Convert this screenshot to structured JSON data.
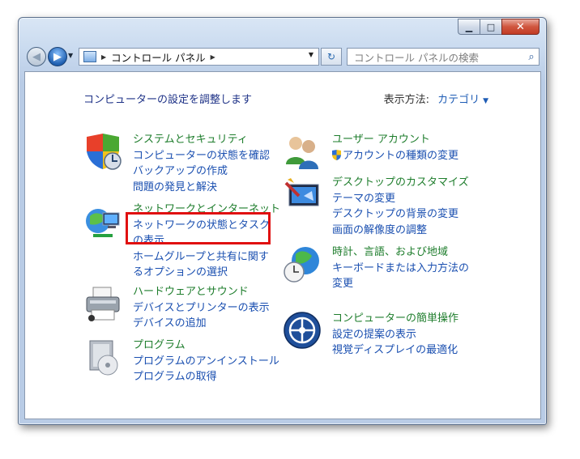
{
  "window": {
    "caption_buttons": {
      "minimize": "▁",
      "maximize": "□",
      "close": "✕"
    }
  },
  "nav": {
    "address_parts": [
      "コントロール パネル"
    ],
    "search_placeholder": "コントロール パネルの検索"
  },
  "content": {
    "title": "コンピューターの設定を調整します",
    "view_by_label": "表示方法:",
    "view_by_value": "カテゴリ"
  },
  "categories_left": [
    {
      "icon": "shield-security-icon",
      "heading": "システムとセキュリティ",
      "links": [
        "コンピューターの状態を確認",
        "バックアップの作成",
        "問題の発見と解決"
      ]
    },
    {
      "icon": "network-icon",
      "heading": "ネットワークとインターネット",
      "links": [
        "ネットワークの状態とタスクの表示",
        "ホームグループと共有に関するオプションの選択"
      ]
    },
    {
      "icon": "printer-icon",
      "heading": "ハードウェアとサウンド",
      "links": [
        "デバイスとプリンターの表示",
        "デバイスの追加"
      ]
    },
    {
      "icon": "programs-icon",
      "heading": "プログラム",
      "links": [
        "プログラムのアンインストール",
        "プログラムの取得"
      ]
    }
  ],
  "categories_right": [
    {
      "icon": "user-accounts-icon",
      "heading": "ユーザー アカウント",
      "links": [
        "アカウントの種類の変更"
      ]
    },
    {
      "icon": "appearance-icon",
      "heading": "デスクトップのカスタマイズ",
      "links": [
        "テーマの変更",
        "デスクトップの背景の変更",
        "画面の解像度の調整"
      ]
    },
    {
      "icon": "clock-globe-icon",
      "heading": "時計、言語、および地域",
      "links": [
        "キーボードまたは入力方法の変更"
      ]
    },
    {
      "icon": "ease-of-access-icon",
      "heading": "コンピューターの簡単操作",
      "links": [
        "設定の提案の表示",
        "視覚ディスプレイの最適化"
      ]
    }
  ],
  "colors": {
    "heading": "#1e7d2c",
    "link": "#1a4fb0",
    "highlight": "#e01010"
  }
}
